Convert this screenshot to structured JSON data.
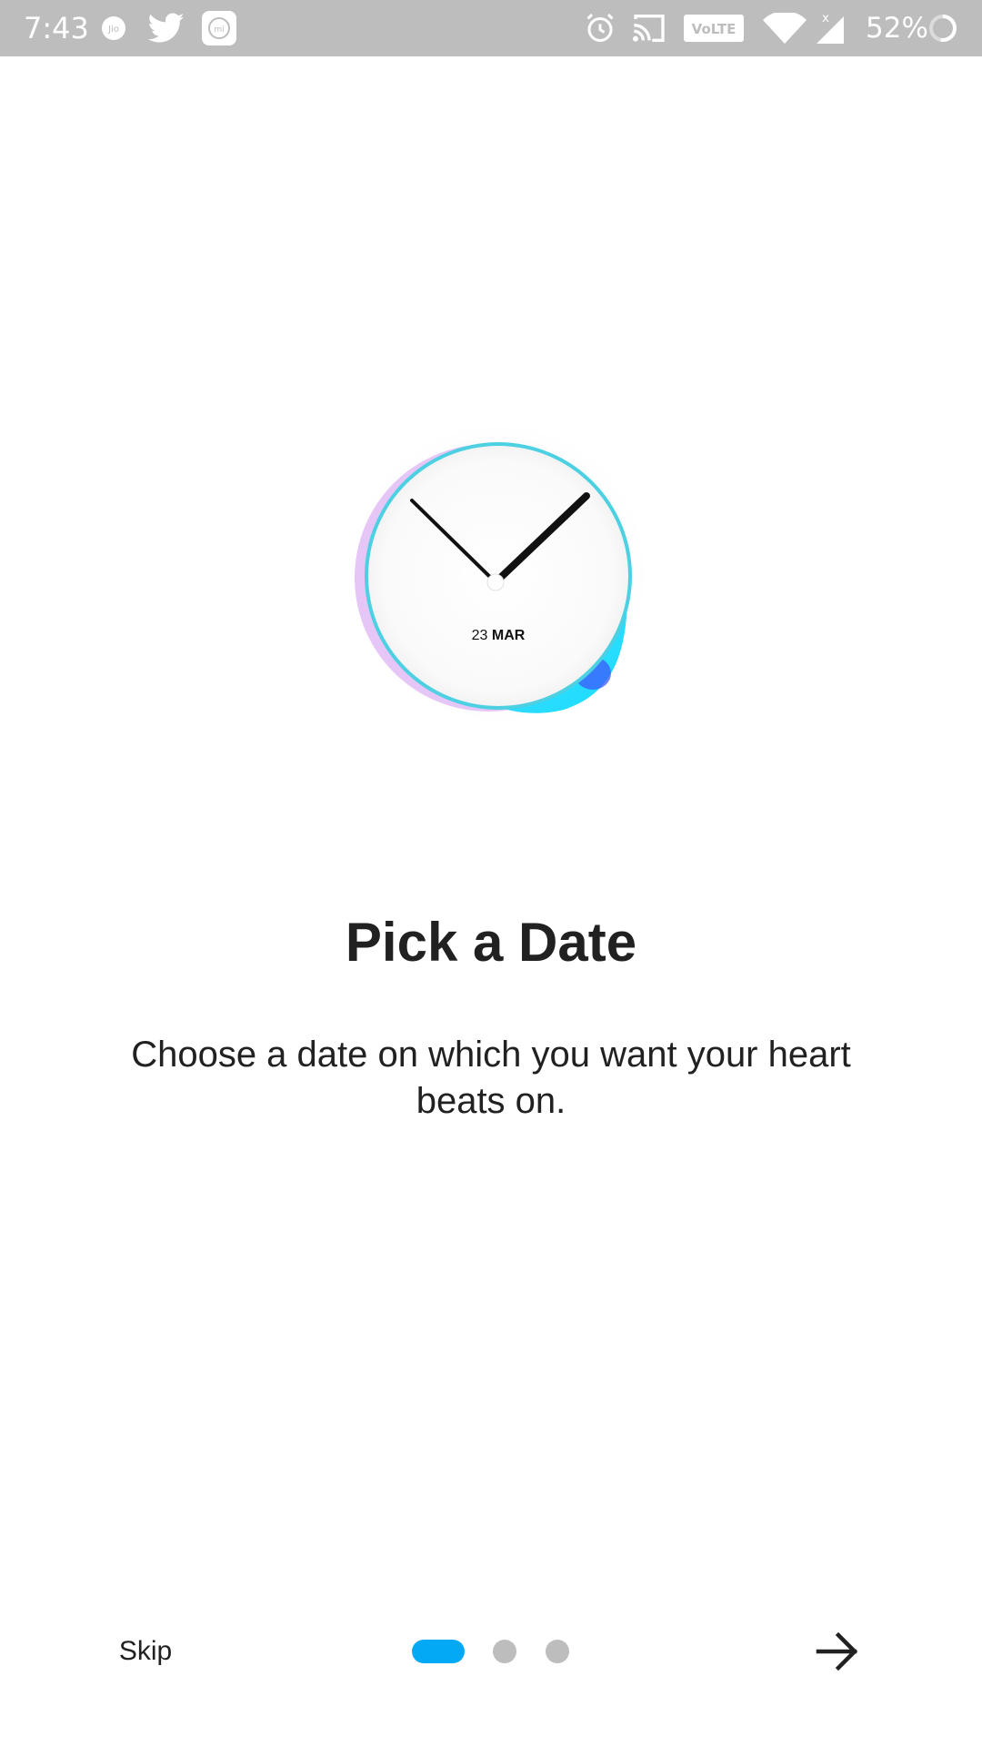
{
  "status_bar": {
    "time": "7:43",
    "battery_percent": "52%",
    "volte_label": "VoLTE",
    "icons": [
      "jio-icon",
      "twitter-icon",
      "mi-icon",
      "alarm-icon",
      "cast-icon",
      "volte-icon",
      "wifi-icon",
      "signal-icon",
      "battery-icon"
    ]
  },
  "illustration": {
    "icon": "clock-icon",
    "date_day": "23",
    "date_month": "MAR"
  },
  "onboarding": {
    "title": "Pick a Date",
    "description": "Choose a date on which you want your heart beats on."
  },
  "navigation": {
    "skip_label": "Skip",
    "page_count": 3,
    "current_page": 1,
    "next_icon": "arrow-right-icon"
  },
  "colors": {
    "accent": "#03a9f4",
    "inactive_dot": "#bdbdbd",
    "status_bar": "#bdbdbd",
    "text": "#212121"
  }
}
